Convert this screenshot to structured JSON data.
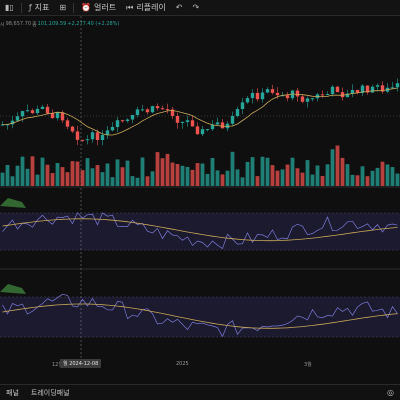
{
  "toolbar": {
    "indicator_label": "지표",
    "alert_label": "얼러트",
    "replay_label": "리플레이"
  },
  "legend": {
    "open_key": "시",
    "open_value": "98,657.70",
    "close_key": "종",
    "close_value": "101,109.59",
    "change": "+2,277.40 (+2.28%)"
  },
  "time_axis": {
    "ticks": [
      "12월",
      "2025",
      "3월"
    ],
    "crosshair_date": "월 2024-12-08"
  },
  "bottom_bar": {
    "panel_label": "패널",
    "trading_panel_label": "트레이딩패널"
  },
  "colors": {
    "up": "#26a69a",
    "down": "#ef5350",
    "ma_line": "#c9a85a",
    "osc_line": "#7b7bd9",
    "band_fill": "#1c1a2e"
  },
  "icons": [
    "bars-icon",
    "fx-icon",
    "indicator-icon",
    "alert-icon",
    "replay-icon",
    "undo-icon",
    "redo-icon",
    "target-icon"
  ]
}
